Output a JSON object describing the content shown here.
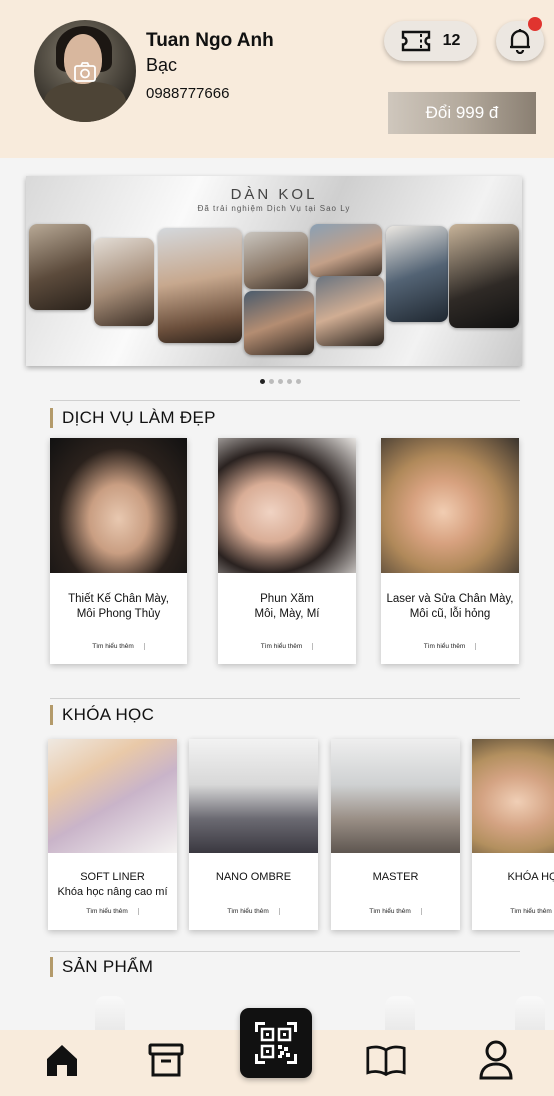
{
  "profile": {
    "name": "Tuan Ngo Anh",
    "tier": "Bạc",
    "phone": "0988777666",
    "ticket_count": "12",
    "redeem_label": "Đổi 999 đ"
  },
  "banner": {
    "title": "DÀN KOL",
    "subtitle": "Đã trải nghiệm Dịch Vụ tại Sao Ly",
    "slide_index": 1,
    "slide_count": 5
  },
  "services": {
    "title": "DỊCH VỤ LÀM ĐẸP",
    "items": [
      {
        "line1": "Thiết Kế Chân Mày,",
        "line2": "Môi Phong Thủy",
        "more": "Tìm hiểu thêm"
      },
      {
        "line1": "Phun Xăm",
        "line2": "Môi, Mày, Mí",
        "more": "Tìm hiểu thêm"
      },
      {
        "line1": "Laser và Sửa Chân Mày,",
        "line2": "Môi cũ, lỗi hỏng",
        "more": "Tìm hiểu thêm"
      }
    ]
  },
  "courses": {
    "title": "KHÓA HỌC",
    "items": [
      {
        "line1": "SOFT LINER",
        "line2": "Khóa học nâng cao mí",
        "more": "Tìm hiểu thêm"
      },
      {
        "line1": "NANO OMBRE",
        "line2": "",
        "more": "Tìm hiểu thêm"
      },
      {
        "line1": "MASTER",
        "line2": "",
        "more": "Tìm hiểu thêm"
      },
      {
        "line1": "KHÓA HỌC",
        "line2": "",
        "more": "Tìm hiểu thêm"
      }
    ]
  },
  "products": {
    "title": "SẢN PHẨM"
  },
  "nav": {
    "items": [
      "home-icon",
      "archive-icon",
      "qr-code-icon",
      "book-icon",
      "user-icon"
    ]
  },
  "colors": {
    "header_bg": "#f8ebdc",
    "accent_bar": "#b39a6a",
    "notification_dot": "#e0342f"
  }
}
